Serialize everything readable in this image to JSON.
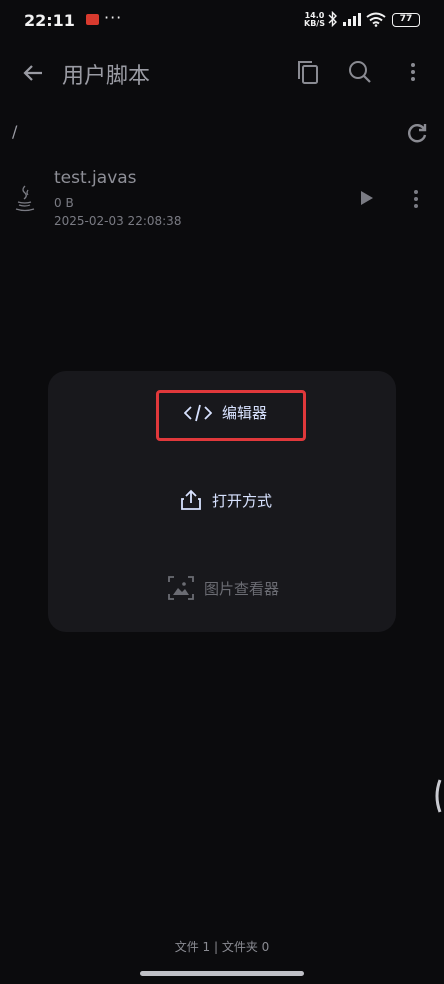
{
  "status_bar": {
    "time": "22:11",
    "more": "···",
    "network_speed_value": "14.0",
    "network_speed_unit": "KB/S",
    "battery": "77"
  },
  "toolbar": {
    "title": "用户脚本"
  },
  "path": "/",
  "file": {
    "name": "test.javas",
    "size": "0 B",
    "modified": "2025-02-03 22:08:38"
  },
  "chooser": {
    "options": [
      {
        "label": "编辑器",
        "icon": "code-icon",
        "enabled": true
      },
      {
        "label": "打开方式",
        "icon": "share-icon",
        "enabled": true
      },
      {
        "label": "图片查看器",
        "icon": "image-scan-icon",
        "enabled": false
      }
    ]
  },
  "footer": {
    "count": "文件 1 | 文件夹 0"
  },
  "colors": {
    "background": "#0b0b0d",
    "sheet": "#18181c",
    "accent": "#d8e2ff",
    "highlight": "#e0383b"
  }
}
